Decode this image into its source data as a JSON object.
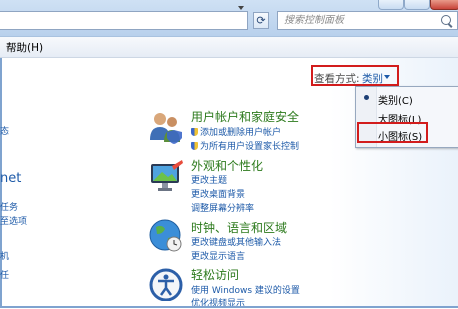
{
  "toolbar": {
    "search_placeholder": "搜索控制面板"
  },
  "menubar": {
    "help": "帮助(H)"
  },
  "left_fragments": [
    "态",
    "net",
    "任务",
    "至选项",
    "机",
    "任"
  ],
  "view_by": {
    "label": "查看方式:",
    "value": "类别"
  },
  "view_menu": {
    "items": [
      "类别(C)",
      "大图标(L)",
      "小图标(S)"
    ],
    "selected": "类别(C)"
  },
  "categories": [
    {
      "title": "用户帐户和家庭安全",
      "links": [
        "添加或删除用户帐户",
        "为所有用户设置家长控制"
      ],
      "icon": "users-icon"
    },
    {
      "title": "外观和个性化",
      "links": [
        "更改主题",
        "更改桌面背景",
        "调整屏幕分辨率"
      ],
      "icon": "appearance-icon"
    },
    {
      "title": "时钟、语言和区域",
      "links": [
        "更改键盘或其他输入法",
        "更改显示语言"
      ],
      "icon": "globe-clock-icon"
    },
    {
      "title": "轻松访问",
      "links": [
        "使用 Windows 建议的设置",
        "优化视频显示"
      ],
      "icon": "ease-of-access-icon"
    }
  ],
  "colors": {
    "highlight": "#d21c1c",
    "link": "#1d5aa8",
    "category_title": "#2c7a1c"
  }
}
